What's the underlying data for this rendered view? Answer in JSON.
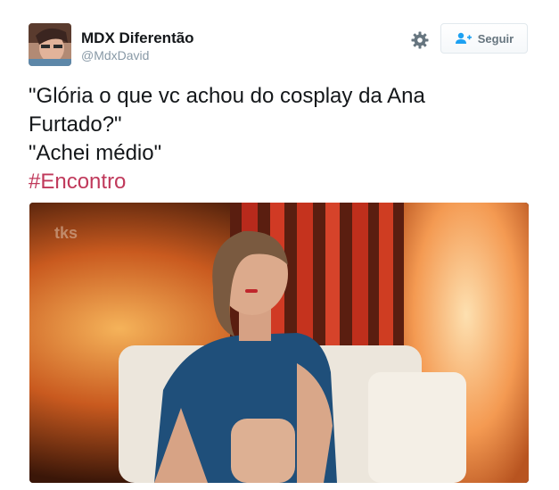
{
  "user": {
    "display_name": "MDX Diferentão",
    "handle": "@MdxDavid"
  },
  "header": {
    "follow_label": "Seguir"
  },
  "tweet": {
    "lines": [
      "\"Glória o que vc achou do cosplay da Ana",
      "Furtado?\"",
      "\"Achei médio\""
    ],
    "hashtag": "#Encontro"
  },
  "media": {
    "description_icons": [
      "gear-icon",
      "add-user-icon"
    ]
  },
  "colors": {
    "hashtag": "#c0395b",
    "follow_border": "#e1e8ed",
    "handle": "#8899a6"
  }
}
